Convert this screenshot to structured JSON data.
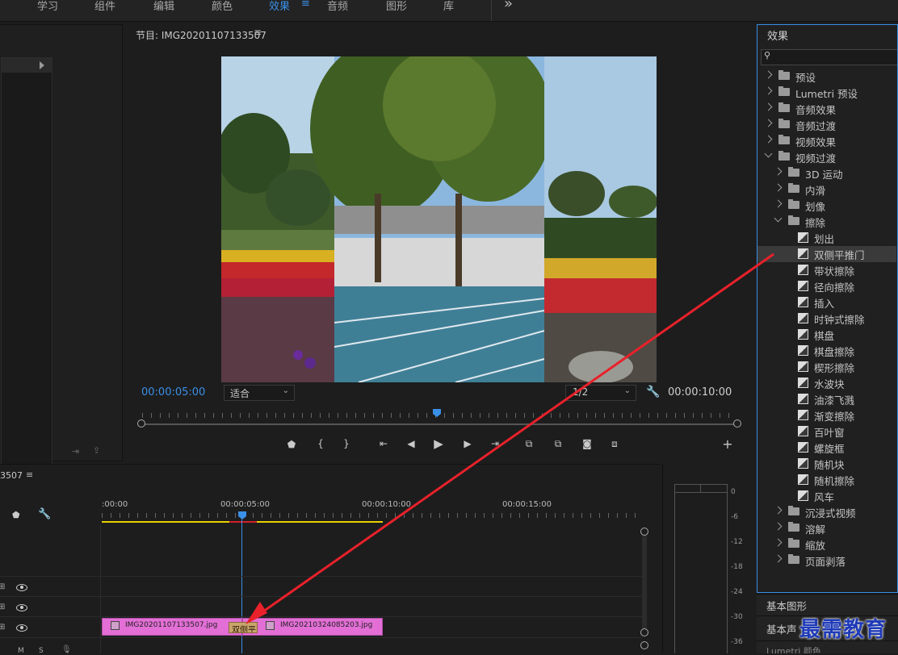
{
  "workspace_tabs": [
    {
      "label": "学习",
      "active": false
    },
    {
      "label": "组件",
      "active": false
    },
    {
      "label": "编辑",
      "active": false
    },
    {
      "label": "颜色",
      "active": false
    },
    {
      "label": "效果",
      "active": true
    },
    {
      "label": "音频",
      "active": false
    },
    {
      "label": "图形",
      "active": false
    },
    {
      "label": "库",
      "active": false
    }
  ],
  "program_monitor": {
    "title": "节目: IMG20201107133507",
    "current_timecode": "00:00:05:00",
    "fit_label": "适合",
    "resolution": "1/2",
    "duration_timecode": "00:00:10:00"
  },
  "timeline": {
    "sequence_name_partial": "3507",
    "ruler_labels": [
      ":00:00",
      "00:00:05:00",
      "00:00:10:00",
      "00:00:15:00"
    ],
    "clip_a": "IMG20201107133507.jpg",
    "transition_label": "双侧平",
    "clip_b": "IMG20210324085203.jpg",
    "track_controls": [
      "M",
      "S"
    ]
  },
  "audio_meter": {
    "labels": [
      "0",
      "-6",
      "-12",
      "-18",
      "-24",
      "-30",
      "-36"
    ]
  },
  "effects_panel": {
    "title": "效果",
    "search_placeholder": "",
    "tree": [
      {
        "label": "预设",
        "type": "preset-folder",
        "level": 0,
        "expanded": false
      },
      {
        "label": "Lumetri 预设",
        "type": "preset-folder",
        "level": 0,
        "expanded": false
      },
      {
        "label": "音频效果",
        "type": "folder",
        "level": 0,
        "expanded": false
      },
      {
        "label": "音频过渡",
        "type": "folder",
        "level": 0,
        "expanded": false
      },
      {
        "label": "视频效果",
        "type": "folder",
        "level": 0,
        "expanded": false
      },
      {
        "label": "视频过渡",
        "type": "folder",
        "level": 0,
        "expanded": true
      },
      {
        "label": "3D 运动",
        "type": "folder",
        "level": 1,
        "expanded": false
      },
      {
        "label": "内滑",
        "type": "folder",
        "level": 1,
        "expanded": false
      },
      {
        "label": "划像",
        "type": "folder",
        "level": 1,
        "expanded": false
      },
      {
        "label": "擦除",
        "type": "folder",
        "level": 1,
        "expanded": true
      },
      {
        "label": "划出",
        "type": "effect",
        "level": 2
      },
      {
        "label": "双侧平推门",
        "type": "effect",
        "level": 2,
        "selected": true
      },
      {
        "label": "带状擦除",
        "type": "effect",
        "level": 2
      },
      {
        "label": "径向擦除",
        "type": "effect",
        "level": 2
      },
      {
        "label": "插入",
        "type": "effect",
        "level": 2
      },
      {
        "label": "时钟式擦除",
        "type": "effect",
        "level": 2
      },
      {
        "label": "棋盘",
        "type": "effect",
        "level": 2
      },
      {
        "label": "棋盘擦除",
        "type": "effect",
        "level": 2
      },
      {
        "label": "楔形擦除",
        "type": "effect",
        "level": 2
      },
      {
        "label": "水波块",
        "type": "effect",
        "level": 2
      },
      {
        "label": "油漆飞溅",
        "type": "effect",
        "level": 2
      },
      {
        "label": "渐变擦除",
        "type": "effect",
        "level": 2
      },
      {
        "label": "百叶窗",
        "type": "effect",
        "level": 2
      },
      {
        "label": "螺旋框",
        "type": "effect",
        "level": 2
      },
      {
        "label": "随机块",
        "type": "effect",
        "level": 2
      },
      {
        "label": "随机擦除",
        "type": "effect",
        "level": 2
      },
      {
        "label": "风车",
        "type": "effect",
        "level": 2
      },
      {
        "label": "沉浸式视频",
        "type": "folder",
        "level": 1,
        "expanded": false
      },
      {
        "label": "溶解",
        "type": "folder",
        "level": 1,
        "expanded": false
      },
      {
        "label": "缩放",
        "type": "folder",
        "level": 1,
        "expanded": false
      },
      {
        "label": "页面剥落",
        "type": "folder",
        "level": 1,
        "expanded": false
      }
    ]
  },
  "bottom_panels": {
    "essential_graphics": "基本图形",
    "essential_sound": "基本声",
    "lumetri_color": "Lumetri 颜色"
  },
  "watermark": "最需教育",
  "colors": {
    "accent": "#3a8fe6",
    "clip": "#e36fd6",
    "arrow": "#e8212a",
    "ruler_work_area": "#e8d000"
  }
}
